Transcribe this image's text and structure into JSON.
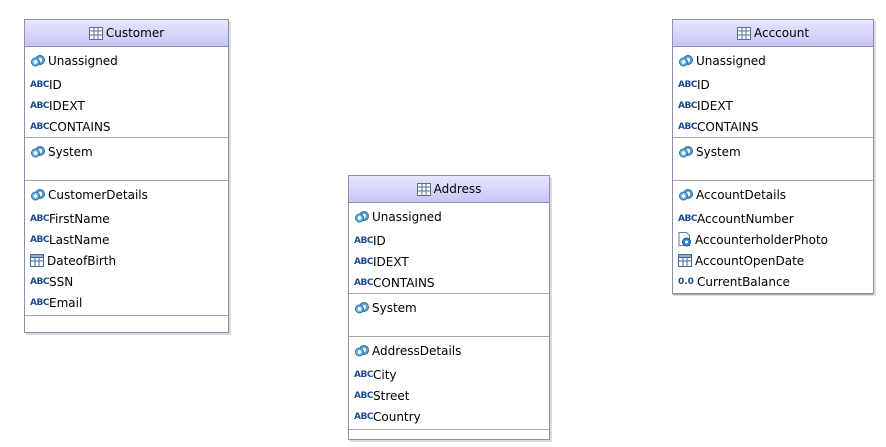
{
  "entities": {
    "customer": {
      "title": "Customer",
      "groups": [
        {
          "title": "Unassigned",
          "attributes": [
            {
              "type": "text",
              "name": "ID"
            },
            {
              "type": "text",
              "name": "IDEXT"
            },
            {
              "type": "text",
              "name": "CONTAINS"
            }
          ]
        },
        {
          "title": "System",
          "attributes": []
        },
        {
          "title": "CustomerDetails",
          "attributes": [
            {
              "type": "text",
              "name": "FirstName"
            },
            {
              "type": "text",
              "name": "LastName"
            },
            {
              "type": "date",
              "name": "DateofBirth"
            },
            {
              "type": "text",
              "name": "SSN"
            },
            {
              "type": "text",
              "name": "Email"
            }
          ]
        }
      ]
    },
    "address": {
      "title": "Address",
      "groups": [
        {
          "title": "Unassigned",
          "attributes": [
            {
              "type": "text",
              "name": "ID"
            },
            {
              "type": "text",
              "name": "IDEXT"
            },
            {
              "type": "text",
              "name": "CONTAINS"
            }
          ]
        },
        {
          "title": "System",
          "attributes": []
        },
        {
          "title": "AddressDetails",
          "attributes": [
            {
              "type": "text",
              "name": "City"
            },
            {
              "type": "text",
              "name": "Street"
            },
            {
              "type": "text",
              "name": "Country"
            }
          ]
        }
      ]
    },
    "account": {
      "title": "Acccount",
      "groups": [
        {
          "title": "Unassigned",
          "attributes": [
            {
              "type": "text",
              "name": "ID"
            },
            {
              "type": "text",
              "name": "IDEXT"
            },
            {
              "type": "text",
              "name": "CONTAINS"
            }
          ]
        },
        {
          "title": "System",
          "attributes": []
        },
        {
          "title": "AccountDetails",
          "attributes": [
            {
              "type": "text",
              "name": "AccountNumber"
            },
            {
              "type": "image",
              "name": "AccounterholderPhoto"
            },
            {
              "type": "date",
              "name": "AccountOpenDate"
            },
            {
              "type": "number",
              "name": "CurrentBalance"
            }
          ]
        }
      ]
    }
  },
  "type_glyphs": {
    "text": "ABC",
    "number": "0.0",
    "date": "calendar-icon",
    "image": "image-icon"
  },
  "group_icon": "attribute-group-icon",
  "entity_icon": "table-icon",
  "colors": {
    "header_top": "#e7e7ff",
    "header_bottom": "#c6c6f6",
    "border": "#8e8ea8",
    "type_label": "#1b4b93"
  }
}
